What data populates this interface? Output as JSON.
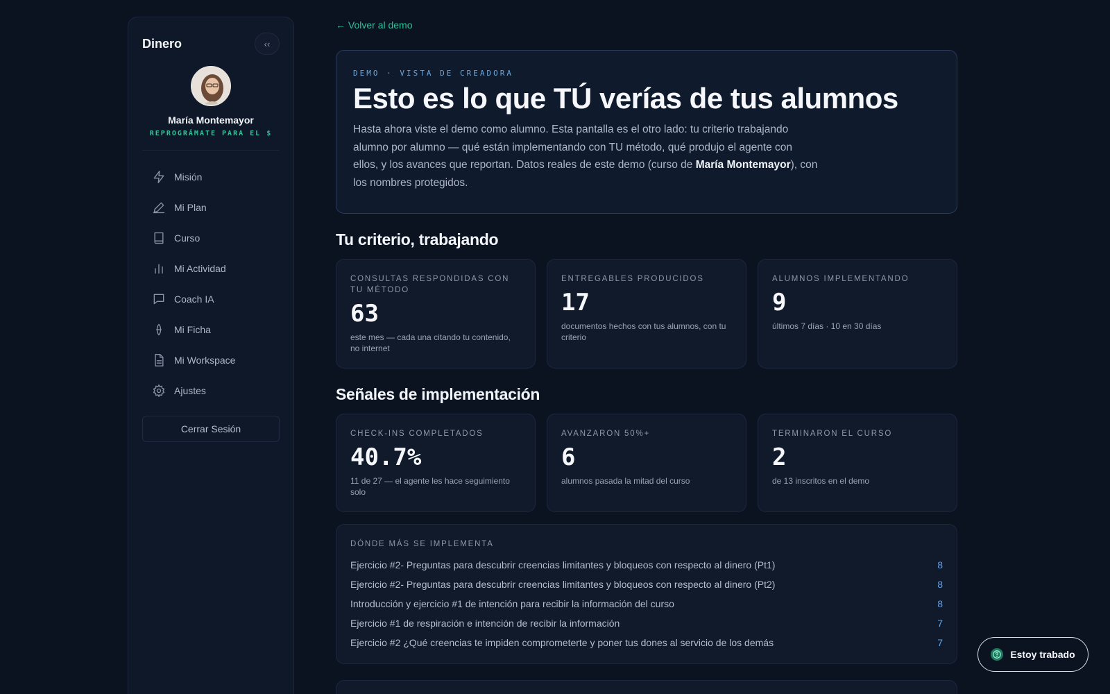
{
  "sidebar": {
    "title": "Dinero",
    "collapse_label": "‹‹",
    "user_name": "María Montemayor",
    "user_tag": "REPROGRÁMATE PARA EL $",
    "items": [
      {
        "label": "Misión",
        "icon": "lightning-icon"
      },
      {
        "label": "Mi Plan",
        "icon": "pencil-icon"
      },
      {
        "label": "Curso",
        "icon": "book-icon"
      },
      {
        "label": "Mi Actividad",
        "icon": "bar-chart-icon"
      },
      {
        "label": "Coach IA",
        "icon": "chat-icon"
      },
      {
        "label": "Mi Ficha",
        "icon": "id-icon"
      },
      {
        "label": "Mi Workspace",
        "icon": "document-icon"
      },
      {
        "label": "Ajustes",
        "icon": "gear-icon"
      }
    ],
    "logout_label": "Cerrar Sesión"
  },
  "back_link": "← Volver al demo",
  "hero": {
    "eyebrow": "DEMO · VISTA DE CREADORA",
    "title": "Esto es lo que TÚ verías de tus alumnos",
    "body_1": "Hasta ahora viste el demo como alumno. Esta pantalla es el otro lado: tu criterio trabajando alumno por alumno — qué están implementando con TU método, qué produjo el agente con ellos, y los avances que reportan. Datos reales de este demo (curso de ",
    "body_name": "María Montemayor",
    "body_2": "), con los nombres protegidos."
  },
  "criterio": {
    "title": "Tu criterio, trabajando",
    "cards": [
      {
        "label": "CONSULTAS RESPONDIDAS CON TU MÉTODO",
        "value": "63",
        "sub": "este mes — cada una citando tu contenido, no internet"
      },
      {
        "label": "ENTREGABLES PRODUCIDOS",
        "value": "17",
        "sub": "documentos hechos con tus alumnos, con tu criterio"
      },
      {
        "label": "ALUMNOS IMPLEMENTANDO",
        "value": "9",
        "sub": "últimos 7 días · 10 en 30 días"
      }
    ]
  },
  "senales": {
    "title": "Señales de implementación",
    "cards": [
      {
        "label": "CHECK-INS COMPLETADOS",
        "value": "40.7%",
        "sub": "11 de 27 — el agente les hace seguimiento solo"
      },
      {
        "label": "AVANZARON 50%+",
        "value": "6",
        "sub": "alumnos pasada la mitad del curso"
      },
      {
        "label": "TERMINARON EL CURSO",
        "value": "2",
        "sub": "de 13 inscritos en el demo"
      }
    ]
  },
  "implementa": {
    "title": "DÓNDE MÁS SE IMPLEMENTA",
    "rows": [
      {
        "label": "Ejercicio #2- Preguntas para descubrir creencias limitantes y bloqueos con respecto al dinero (Pt1)",
        "count": "8"
      },
      {
        "label": "Ejercicio #2- Preguntas para descubrir creencias limitantes y bloqueos con respecto al dinero (Pt2)",
        "count": "8"
      },
      {
        "label": "Introducción y ejercicio #1 de intención para recibir la información del curso",
        "count": "8"
      },
      {
        "label": "Ejercicio #1 de respiración e intención de recibir la información",
        "count": "7"
      },
      {
        "label": "Ejercicio #2 ¿Qué creencias te impiden comprometerte y poner tus dones al servicio de los demás",
        "count": "7"
      }
    ]
  },
  "stuck_button": "Estoy trabado",
  "colors": {
    "accent": "#2fc49a",
    "background": "#0b1220",
    "card": "#101a2b",
    "link_count": "#5fa3ea"
  }
}
